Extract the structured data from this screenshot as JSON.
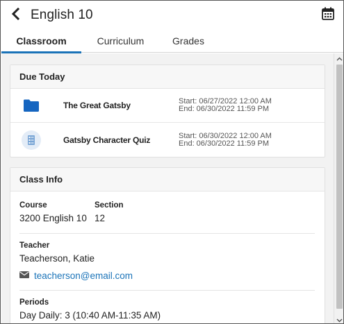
{
  "header": {
    "title": "English 10"
  },
  "tabs": [
    {
      "label": "Classroom",
      "active": true
    },
    {
      "label": "Curriculum",
      "active": false
    },
    {
      "label": "Grades",
      "active": false
    }
  ],
  "due_today": {
    "heading": "Due Today",
    "items": [
      {
        "name": "The Great Gatsby",
        "icon": "folder-icon",
        "start": "Start: 06/27/2022 12:00 AM",
        "end": "End: 06/30/2022 11:59 PM"
      },
      {
        "name": "Gatsby Character Quiz",
        "icon": "quiz-icon",
        "start": "Start: 06/30/2022 12:00 AM",
        "end": "End: 06/30/2022 11:59 PM"
      }
    ]
  },
  "class_info": {
    "heading": "Class Info",
    "course_label": "Course",
    "course_value": "3200 English 10",
    "section_label": "Section",
    "section_value": "12",
    "teacher_label": "Teacher",
    "teacher_value": "Teacherson, Katie",
    "teacher_email": "teacherson@email.com",
    "periods_label": "Periods",
    "periods_value": "Day Daily: 3 (10:40 AM-11:35 AM)"
  },
  "colors": {
    "accent": "#1a73b8",
    "folder": "#1565c0",
    "quiz_bg": "#e3ecf7"
  }
}
